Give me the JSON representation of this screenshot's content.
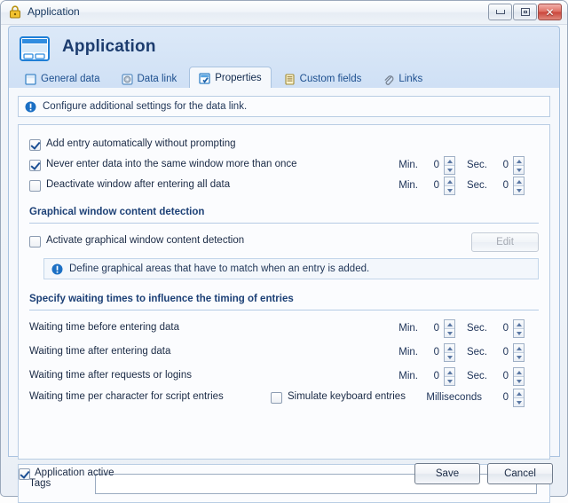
{
  "window": {
    "title": "Application",
    "lock_icon": "lock-icon",
    "buttons": {
      "minimize": "minimize-button",
      "maximize": "maximize-button",
      "close_label": "✕"
    }
  },
  "header": {
    "icon": "application-window-icon",
    "title": "Application"
  },
  "tabs": [
    {
      "label": "General data",
      "icon": "blank-page-icon",
      "active": false
    },
    {
      "label": "Data link",
      "icon": "gear-disc-icon",
      "active": false
    },
    {
      "label": "Properties",
      "icon": "checked-page-icon",
      "active": true
    },
    {
      "label": "Custom fields",
      "icon": "form-list-icon",
      "active": false
    },
    {
      "label": "Links",
      "icon": "paperclip-icon",
      "active": false
    }
  ],
  "info_bar": {
    "icon": "info-icon",
    "text": "Configure additional settings for the data link."
  },
  "options": [
    {
      "label": "Add entry automatically without prompting",
      "checked": true,
      "has_time": false
    },
    {
      "label": "Never enter data into the same window more than once",
      "checked": true,
      "has_time": true
    },
    {
      "label": "Deactivate window after entering all data",
      "checked": false,
      "has_time": true
    }
  ],
  "time_units": {
    "minutes": "Min.",
    "seconds": "Sec.",
    "milliseconds": "Milliseconds"
  },
  "graphical_section": {
    "heading": "Graphical window content detection",
    "checkbox_label": "Activate graphical window content detection",
    "checked": false,
    "edit_button": "Edit",
    "hint_icon": "info-icon",
    "hint": "Define graphical areas that have to match when an entry is added."
  },
  "waiting_section": {
    "heading": "Specify waiting times to influence the timing of entries",
    "rows": [
      {
        "label": "Waiting time before entering data",
        "min": "0",
        "sec": "0"
      },
      {
        "label": "Waiting time after entering data",
        "min": "0",
        "sec": "0"
      },
      {
        "label": "Waiting time after requests or logins",
        "min": "0",
        "sec": "0"
      }
    ],
    "script_row": {
      "label": "Waiting time per character for script entries",
      "checkbox_label": "Simulate keyboard entries",
      "checked": false,
      "value": "0"
    }
  },
  "option_values": [
    {
      "min": "0",
      "sec": "0"
    },
    {
      "min": "0",
      "sec": "0"
    }
  ],
  "tags": {
    "label": "Tags",
    "value": "",
    "placeholder": ""
  },
  "footer": {
    "active_label": "Application active",
    "active_checked": true,
    "save_label": "Save",
    "cancel_label": "Cancel"
  },
  "colors": {
    "accent": "#1c4076",
    "header_bg": "#cfe0f5",
    "panel_bg": "#f5f8fc",
    "close_red": "#c9453a"
  }
}
